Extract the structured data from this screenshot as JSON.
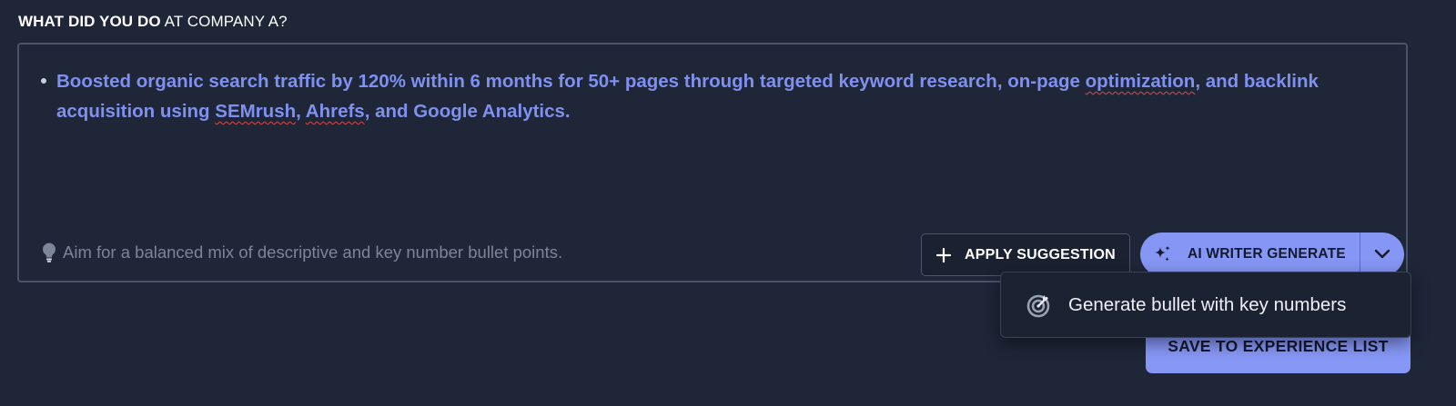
{
  "question": {
    "strong": "WHAT DID YOU DO",
    "rest": " AT COMPANY A?"
  },
  "editor": {
    "bullets": [
      {
        "parts": [
          "Boosted organic search traffic by 120% within 6 months for 50+ pages through targeted keyword research, on-page ",
          "optimization",
          ", and backlink acquisition using ",
          "SEMrush",
          ", ",
          "Ahrefs",
          ", and Google Analytics."
        ]
      }
    ],
    "tip": "Aim for a balanced mix of descriptive and key number bullet points."
  },
  "buttons": {
    "apply_suggestion": "APPLY SUGGESTION",
    "ai_writer_generate": "AI WRITER GENERATE",
    "save": "SAVE TO EXPERIENCE LIST"
  },
  "dropdown": {
    "item": "Generate bullet with key numbers"
  },
  "icons": {
    "tip": "lightbulb-icon",
    "apply": "plus-icon",
    "ai": "sparkle-icon",
    "caret": "chevron-down-icon",
    "dropdown_item": "target-icon"
  },
  "colors": {
    "background": "#1e2638",
    "accent": "#8696f4",
    "bullet_text": "#7f90f0",
    "spellcheck": "#e04848"
  }
}
